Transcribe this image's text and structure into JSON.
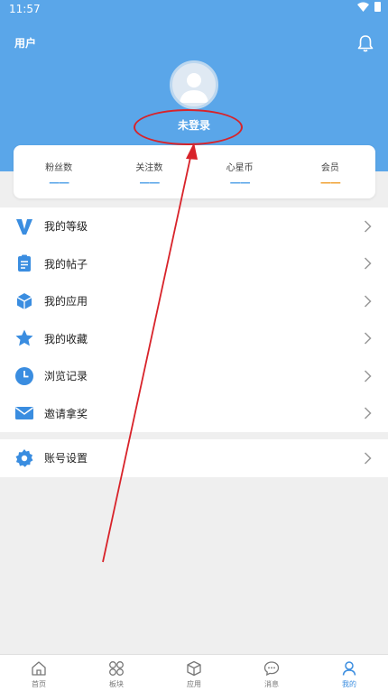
{
  "status": {
    "time": "11:57"
  },
  "header": {
    "title": "用户",
    "login_label": "未登录"
  },
  "stats": [
    {
      "label": "粉丝数",
      "value": "——"
    },
    {
      "label": "关注数",
      "value": "——"
    },
    {
      "label": "心星币",
      "value": "——"
    },
    {
      "label": "会员",
      "value": "——"
    }
  ],
  "menu": [
    {
      "label": "我的等级"
    },
    {
      "label": "我的帖子"
    },
    {
      "label": "我的应用"
    },
    {
      "label": "我的收藏"
    },
    {
      "label": "浏览记录"
    },
    {
      "label": "邀请拿奖"
    }
  ],
  "settings": {
    "label": "账号设置"
  },
  "nav": [
    {
      "label": "首页"
    },
    {
      "label": "板块"
    },
    {
      "label": "应用"
    },
    {
      "label": "消息"
    },
    {
      "label": "我的"
    }
  ],
  "colors": {
    "header": "#5aa6e9",
    "accent": "#3a8de0",
    "annotation": "#d8232a",
    "vip": "#f1a43a"
  }
}
